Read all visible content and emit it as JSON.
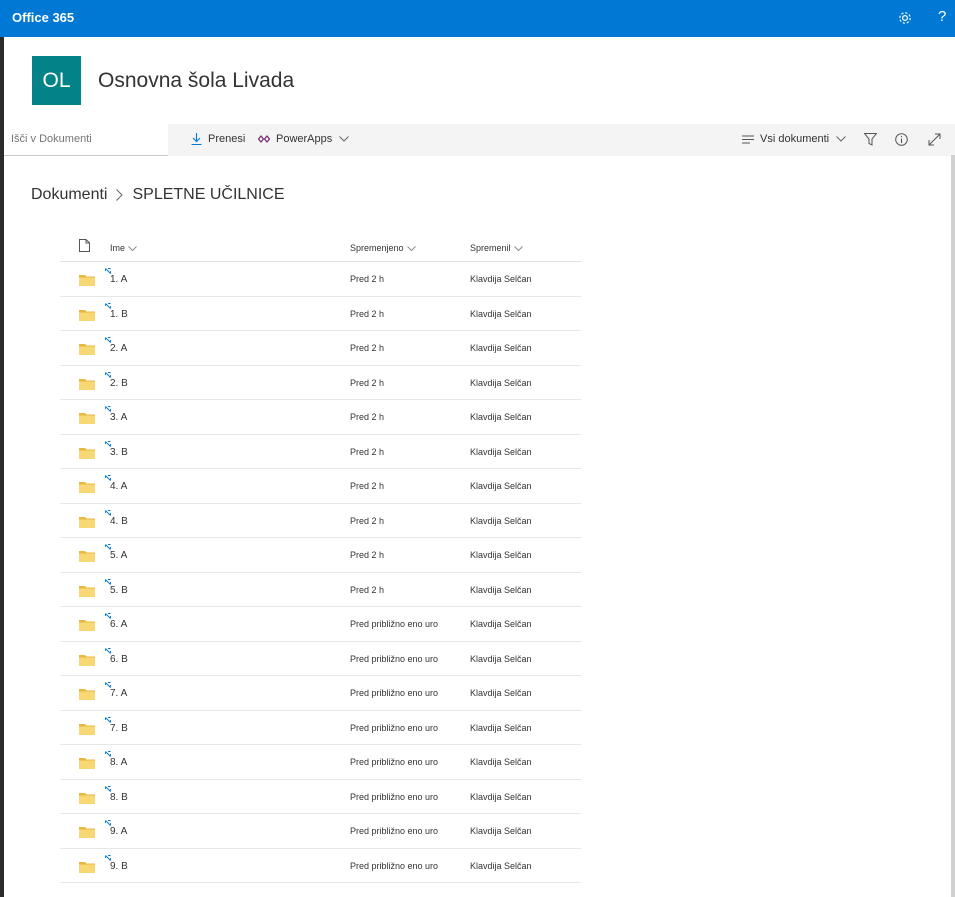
{
  "topbar": {
    "brand": "Office 365",
    "settings_icon": "gear-icon",
    "help_label": "?",
    "bg_color": "#0078d4"
  },
  "site": {
    "logo_text": "OL",
    "logo_color": "#038387",
    "title": "Osnovna šola Livada"
  },
  "commandbar": {
    "search_placeholder": "Išči v Dokumenti",
    "download_label": "Prenesi",
    "powerapps_label": "PowerApps",
    "view_label": "Vsi dokumenti"
  },
  "breadcrumb": {
    "root": "Dokumenti",
    "current": "SPLETNE UČILNICE"
  },
  "columns": {
    "name": "Ime",
    "modified": "Spremenjeno",
    "modified_by": "Spremenil"
  },
  "rows": [
    {
      "name": "1. A",
      "modified": "Pred 2 h",
      "modified_by": "Klavdija Selčan"
    },
    {
      "name": "1. B",
      "modified": "Pred 2 h",
      "modified_by": "Klavdija Selčan"
    },
    {
      "name": "2. A",
      "modified": "Pred 2 h",
      "modified_by": "Klavdija Selčan"
    },
    {
      "name": "2. B",
      "modified": "Pred 2 h",
      "modified_by": "Klavdija Selčan"
    },
    {
      "name": "3. A",
      "modified": "Pred 2 h",
      "modified_by": "Klavdija Selčan"
    },
    {
      "name": "3. B",
      "modified": "Pred 2 h",
      "modified_by": "Klavdija Selčan"
    },
    {
      "name": "4. A",
      "modified": "Pred 2 h",
      "modified_by": "Klavdija Selčan"
    },
    {
      "name": "4. B",
      "modified": "Pred 2 h",
      "modified_by": "Klavdija Selčan"
    },
    {
      "name": "5. A",
      "modified": "Pred 2 h",
      "modified_by": "Klavdija Selčan"
    },
    {
      "name": "5. B",
      "modified": "Pred 2 h",
      "modified_by": "Klavdija Selčan"
    },
    {
      "name": "6. A",
      "modified": "Pred približno eno uro",
      "modified_by": "Klavdija Selčan"
    },
    {
      "name": "6. B",
      "modified": "Pred približno eno uro",
      "modified_by": "Klavdija Selčan"
    },
    {
      "name": "7. A",
      "modified": "Pred približno eno uro",
      "modified_by": "Klavdija Selčan"
    },
    {
      "name": "7. B",
      "modified": "Pred približno eno uro",
      "modified_by": "Klavdija Selčan"
    },
    {
      "name": "8. A",
      "modified": "Pred približno eno uro",
      "modified_by": "Klavdija Selčan"
    },
    {
      "name": "8. B",
      "modified": "Pred približno eno uro",
      "modified_by": "Klavdija Selčan"
    },
    {
      "name": "9. A",
      "modified": "Pred približno eno uro",
      "modified_by": "Klavdija Selčan"
    },
    {
      "name": "9. B",
      "modified": "Pred približno eno uro",
      "modified_by": "Klavdija Selčan"
    }
  ],
  "colors": {
    "folder": "#f8d775",
    "folder_dark": "#e8b83d",
    "new_indicator": "#0078d4"
  }
}
